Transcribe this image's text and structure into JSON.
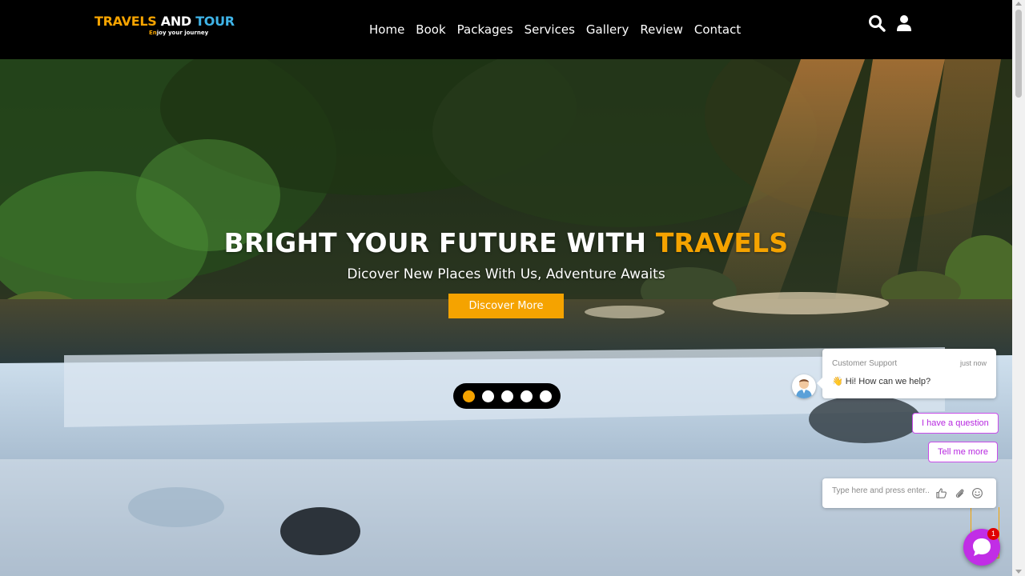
{
  "brand": {
    "title_part1": "TRAVELS",
    "title_part2": "AND",
    "title_part3": "TOUR",
    "tagline_highlight": "En",
    "tagline_rest": "joy your journey"
  },
  "nav": {
    "items": [
      "Home",
      "Book",
      "Packages",
      "Services",
      "Gallery",
      "Review",
      "Contact"
    ]
  },
  "header_icons": [
    "search-icon",
    "user-icon"
  ],
  "hero": {
    "title_main": "BRIGHT YOUR FUTURE WITH ",
    "title_highlight": "TRAVELS",
    "subtitle": "Dicover New Places With Us, Adventure Awaits",
    "cta_label": "Discover More",
    "slides_total": 5,
    "active_slide": 1
  },
  "chat": {
    "agent": "Customer Support",
    "time": "just now",
    "greeting_emoji": "👋",
    "message": "Hi! How can we help?",
    "quick_replies": [
      "I have a question",
      "Tell me more"
    ],
    "input_placeholder": "Type here and press enter..",
    "unread_count": "1"
  },
  "colors": {
    "accent": "#f5a300",
    "logo_blue": "#3fb4e8",
    "chat_purple": "#c12de6",
    "header_bg": "#000000"
  }
}
